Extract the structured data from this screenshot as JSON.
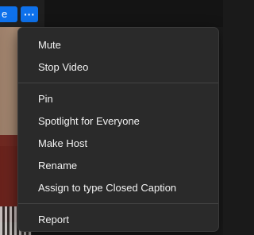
{
  "participant": {
    "name_fragment": "e"
  },
  "toolbar": {
    "more_label": "···"
  },
  "menu": {
    "group1": [
      "Mute",
      "Stop Video"
    ],
    "group2": [
      "Pin",
      "Spotlight for Everyone",
      "Make Host",
      "Rename",
      "Assign to type Closed Caption"
    ],
    "group3": [
      "Report"
    ]
  },
  "colors": {
    "accent": "#0e71eb",
    "menu_bg": "#2a2a2a",
    "text": "#f2f2f2"
  }
}
